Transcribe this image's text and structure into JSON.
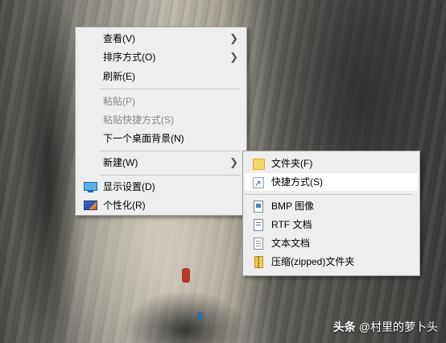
{
  "desktop_menu": {
    "items": [
      {
        "label": "查看(V)",
        "submenu": true
      },
      {
        "label": "排序方式(O)",
        "submenu": true
      },
      {
        "label": "刷新(E)"
      },
      {
        "label": "粘贴(P)",
        "disabled": true
      },
      {
        "label": "粘贴快捷方式(S)",
        "disabled": true
      },
      {
        "label": "下一个桌面背景(N)"
      },
      {
        "label": "新建(W)",
        "submenu": true
      },
      {
        "label": "显示设置(D)",
        "icon": "display-icon"
      },
      {
        "label": "个性化(R)",
        "icon": "personalize-icon"
      }
    ]
  },
  "new_submenu": {
    "items": [
      {
        "label": "文件夹(F)",
        "icon": "folder-icon"
      },
      {
        "label": "快捷方式(S)",
        "icon": "shortcut-icon",
        "highlighted": true
      },
      {
        "label": "BMP 图像",
        "icon": "bmp-image-icon"
      },
      {
        "label": "RTF 文档",
        "icon": "rtf-document-icon"
      },
      {
        "label": "文本文档",
        "icon": "text-document-icon"
      },
      {
        "label": "压缩(zipped)文件夹",
        "icon": "zip-folder-icon"
      }
    ]
  },
  "watermark": {
    "source": "头条",
    "author": "@村里的萝卜头"
  },
  "colors": {
    "menu_bg": "#eeeeee",
    "highlight": "#ffffff",
    "disabled_text": "#8a8a8a"
  }
}
